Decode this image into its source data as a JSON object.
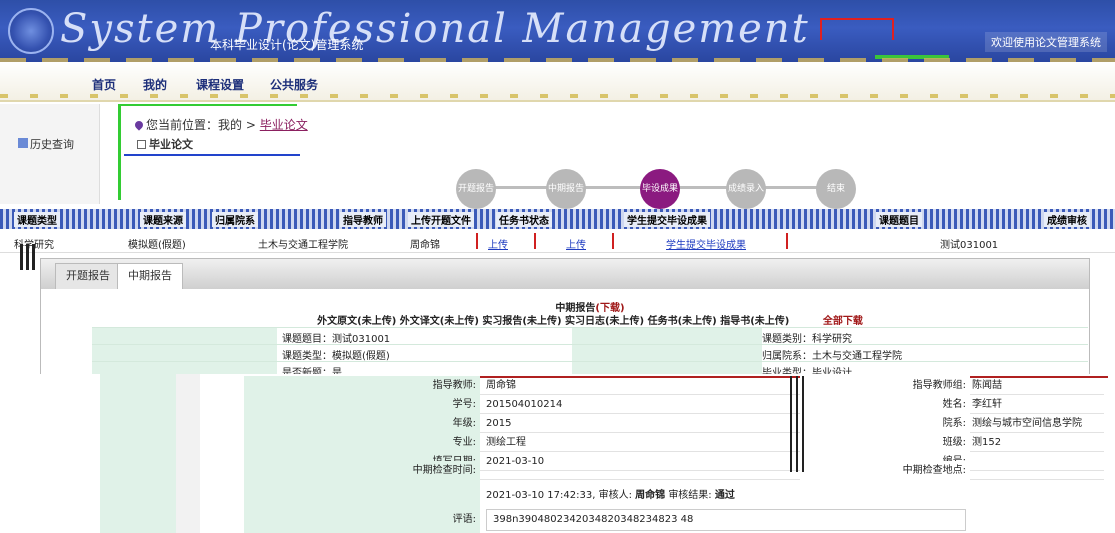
{
  "banner": {
    "script_text": "System Professional Management",
    "system_name": "本科毕业设计(论文)管理系统",
    "right_text": "欢迎使用论文管理系统"
  },
  "nav": {
    "items": [
      "首页",
      "我的",
      "课程设置",
      "公共服务"
    ]
  },
  "sidebar": {
    "history": "历史查询"
  },
  "breadcrumb": {
    "prefix": "您当前位置：我的",
    "sep": ">",
    "current": "毕业论文",
    "sub": "毕业论文"
  },
  "steps": [
    {
      "label": "开题报告",
      "active": false
    },
    {
      "label": "中期报告",
      "active": false
    },
    {
      "label": "毕设成果",
      "active": true
    },
    {
      "label": "成绩录入",
      "active": false
    },
    {
      "label": "结束",
      "active": false
    }
  ],
  "info_table": {
    "headers": [
      "课题类型",
      "课题来源",
      "归属院系",
      "指导教师",
      "上传开题文件",
      "任务书状态",
      "学生提交毕设成果",
      "课题题目",
      "成绩审核"
    ],
    "row": {
      "type": "科学研究",
      "source": "模拟题(假题)",
      "dept": "土木与交通工程学院",
      "teacher": "周命锦",
      "upload1": "上传",
      "upload2": "上传",
      "submit": "学生提交毕设成果",
      "title": "测试031001"
    }
  },
  "tabs": [
    {
      "label": "开题报告",
      "active": false
    },
    {
      "label": "中期报告",
      "active": true
    }
  ],
  "report": {
    "title": "中期报告",
    "download": "(下载)",
    "uploads": "外文原文(未上传)  外文译文(未上传)  实习报告(未上传)  实习日志(未上传)  任务书(未上传)  指导书(未上传)",
    "download_all": "全部下载",
    "rows": [
      {
        "left": "课题题目：测试031001",
        "right": "课题类别：科学研究"
      },
      {
        "left": "课题类型：模拟题(假题)",
        "right": "归属院系：土木与交通工程学院"
      },
      {
        "left": "是否新题：是",
        "right": "毕业类型：毕业设计"
      }
    ]
  },
  "details": {
    "rows": [
      {
        "k": "指导教师:",
        "v": "周命锦",
        "k2": "指导教师组:",
        "v2": "陈闻喆"
      },
      {
        "k": "学号:",
        "v": "201504010214",
        "k2": "姓名:",
        "v2": "李红轩"
      },
      {
        "k": "年级:",
        "v": "2015",
        "k2": "院系:",
        "v2": "测绘与城市空间信息学院"
      },
      {
        "k": "专业:",
        "v": "测绘工程",
        "k2": "班级:",
        "v2": "测152"
      },
      {
        "k": "填写日期:",
        "v": "2021-03-10",
        "k2": "编号:",
        "v2": ""
      },
      {
        "k": "中期检查时间:",
        "v": "",
        "k2": "中期检查地点:",
        "v2": ""
      }
    ],
    "check_time": "2021-03-10 17:42:33, 审核人:",
    "checker": "周命锦",
    "check_result_label": "审核结果:",
    "check_result": "通过",
    "comment_label": "评语:",
    "comment": "398n3904802342034820348234823 48"
  },
  "colors": {
    "banner": "#3a5cc0",
    "nav_text": "#1d2f7a",
    "active_step": "#8b1a80",
    "label_green": "#e0f2e8",
    "link": "#1f3cc0",
    "download_red": "#a01818"
  }
}
